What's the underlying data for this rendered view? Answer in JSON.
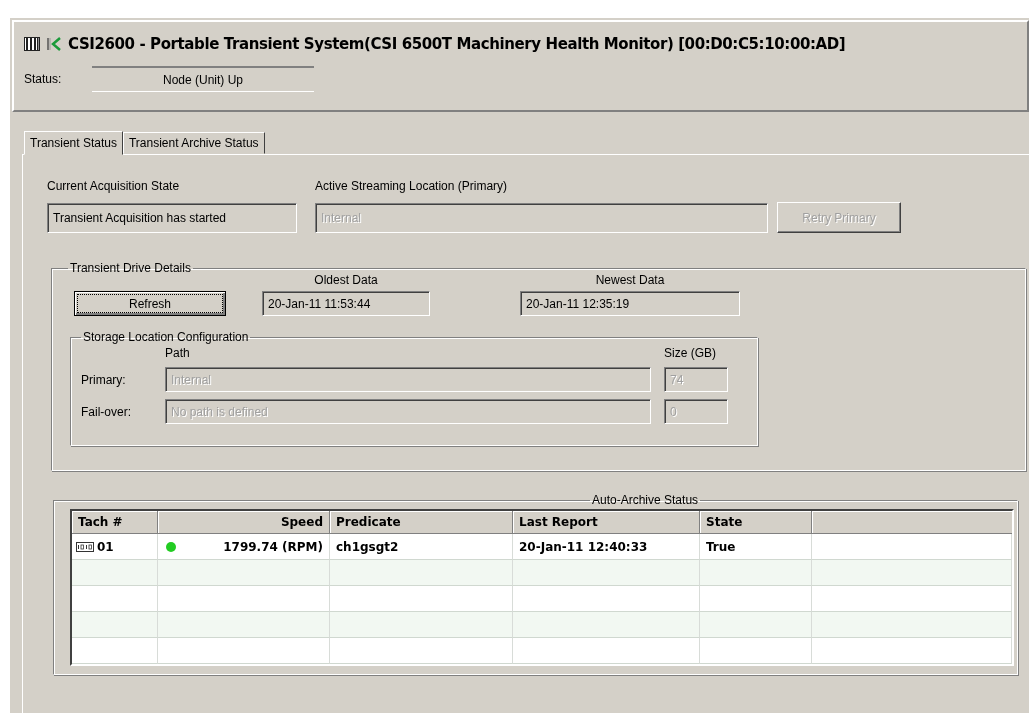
{
  "header": {
    "title": "CSI2600 - Portable Transient System(CSI 6500T Machinery Health Monitor) [00:D0:C5:10:00:AD]",
    "status_label": "Status:",
    "status_value": "Node (Unit) Up"
  },
  "tabs": [
    {
      "label": "Transient Status",
      "selected": true
    },
    {
      "label": "Transient Archive Status",
      "selected": false
    }
  ],
  "acquisition": {
    "label": "Current Acquisition State",
    "value": "Transient Acquisition has started",
    "disabled": false
  },
  "streaming": {
    "label": "Active Streaming Location (Primary)",
    "value": "Internal",
    "disabled": true
  },
  "retry_button": {
    "label": "Retry Primary",
    "disabled": true
  },
  "drive_details": {
    "title": "Transient Drive Details",
    "refresh_button": {
      "label": "Refresh",
      "focused": true
    },
    "oldest": {
      "label": "Oldest Data",
      "value": "20-Jan-11 11:53:44"
    },
    "newest": {
      "label": "Newest Data",
      "value": "20-Jan-11 12:35:19"
    }
  },
  "storage": {
    "title": "Storage Location Configuration",
    "path_header": "Path",
    "size_header": "Size (GB)",
    "rows": [
      {
        "label": "Primary:",
        "path": "Internal",
        "size": "74",
        "disabled": true
      },
      {
        "label": "Fail-over:",
        "path": "No path is defined",
        "size": "0",
        "disabled": true
      }
    ]
  },
  "archive": {
    "title": "Auto-Archive Status",
    "columns": [
      "Tach #",
      "Speed",
      "Predicate",
      "Last Report",
      "State"
    ],
    "rows": [
      {
        "tach": "01",
        "color": "#22cc22",
        "speed": "1799.74 (RPM)",
        "predicate": "ch1gsgt2",
        "last_report": "20-Jan-11 12:40:33",
        "state": "True"
      }
    ]
  }
}
